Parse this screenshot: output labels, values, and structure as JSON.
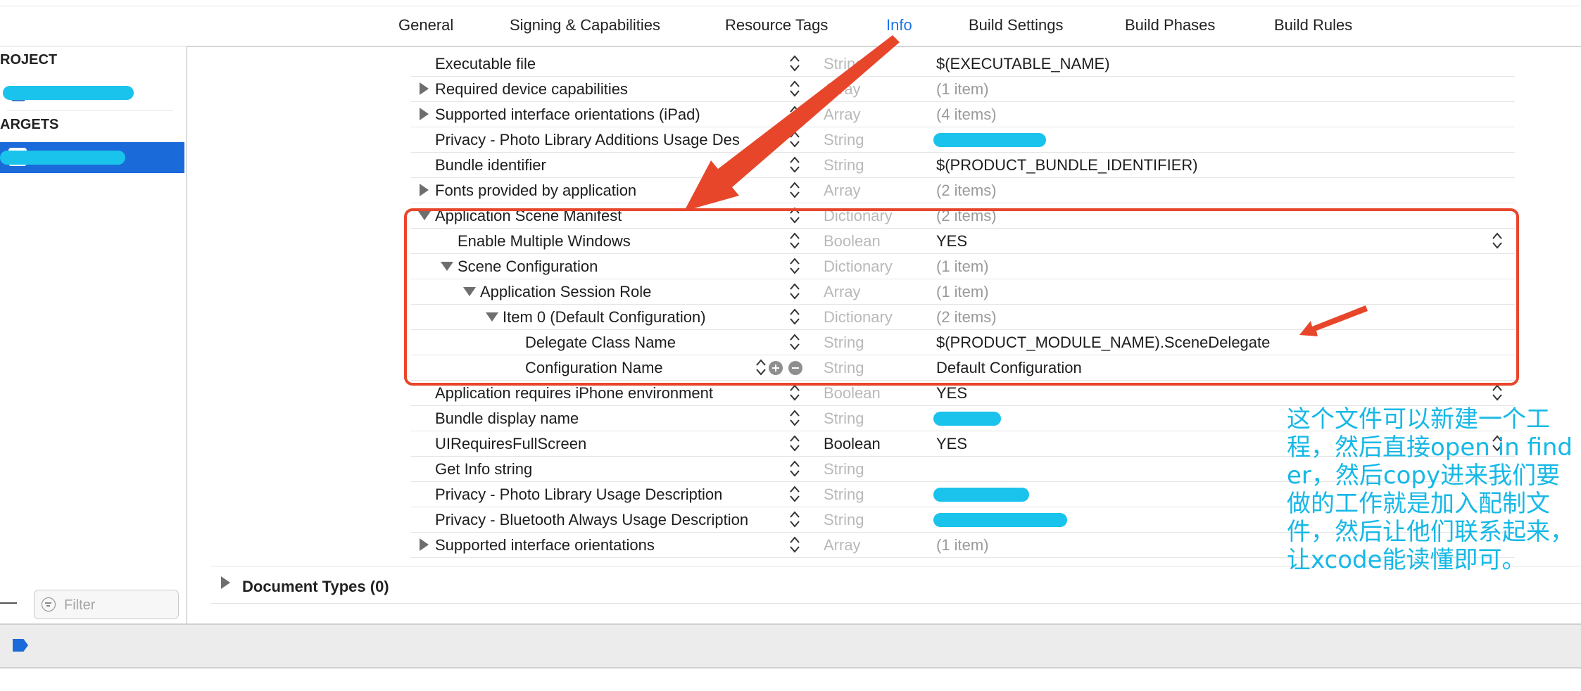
{
  "tabs": [
    {
      "label": "General",
      "active": false
    },
    {
      "label": "Signing & Capabilities",
      "active": false
    },
    {
      "label": "Resource Tags",
      "active": false
    },
    {
      "label": "Info",
      "active": true
    },
    {
      "label": "Build Settings",
      "active": false
    },
    {
      "label": "Build Phases",
      "active": false
    },
    {
      "label": "Build Rules",
      "active": false
    }
  ],
  "sidebar": {
    "project_heading": "ROJECT",
    "targets_heading": "ARGETS",
    "filter_placeholder": "Filter"
  },
  "plist_rows": [
    {
      "key": "Executable file",
      "type": "String",
      "value": "$(EXECUTABLE_NAME)"
    },
    {
      "key": "Required device capabilities",
      "type": "Array",
      "value": "(1 item)",
      "disclosure": "collapsed"
    },
    {
      "key": "Supported interface orientations (iPad)",
      "type": "Array",
      "value": "(4 items)",
      "disclosure": "collapsed"
    },
    {
      "key": "Privacy - Photo Library Additions Usage Des",
      "type": "String",
      "value": ""
    },
    {
      "key": "Bundle identifier",
      "type": "String",
      "value": "$(PRODUCT_BUNDLE_IDENTIFIER)"
    },
    {
      "key": "Fonts provided by application",
      "type": "Array",
      "value": "(2 items)",
      "disclosure": "collapsed"
    },
    {
      "key": "Application Scene Manifest",
      "type": "Dictionary",
      "value": "(2 items)",
      "disclosure": "expanded"
    },
    {
      "key": "Enable Multiple Windows",
      "type": "Boolean",
      "value": "YES",
      "indent": 1
    },
    {
      "key": "Scene Configuration",
      "type": "Dictionary",
      "value": "(1 item)",
      "disclosure": "expanded",
      "indent": 1
    },
    {
      "key": "Application Session Role",
      "type": "Array",
      "value": "(1 item)",
      "disclosure": "expanded",
      "indent": 2
    },
    {
      "key": "Item 0 (Default Configuration)",
      "type": "Dictionary",
      "value": "(2 items)",
      "disclosure": "expanded",
      "indent": 3
    },
    {
      "key": "Delegate Class Name",
      "type": "String",
      "value": "$(PRODUCT_MODULE_NAME).SceneDelegate",
      "indent": 4
    },
    {
      "key": "Configuration Name",
      "type": "String",
      "value": "Default Configuration",
      "indent": 4
    },
    {
      "key": "Application requires iPhone environment",
      "type": "Boolean",
      "value": "YES"
    },
    {
      "key": "Bundle display name",
      "type": "String",
      "value": ""
    },
    {
      "key": "UIRequiresFullScreen",
      "type": "Boolean",
      "value": "YES"
    },
    {
      "key": "Get Info string",
      "type": "String",
      "value": ""
    },
    {
      "key": "Privacy - Photo Library Usage Description",
      "type": "String",
      "value": ""
    },
    {
      "key": "Privacy - Bluetooth Always Usage Description",
      "type": "String",
      "value": ""
    },
    {
      "key": "Supported interface orientations",
      "type": "Array",
      "value": "(1 item)",
      "disclosure": "collapsed"
    }
  ],
  "document_types": "Document Types (0)",
  "annotation_note": "这个文件可以新建一个工程，然后直接open in finder，然后copy进来我们要做的工作就是加入配制文件，然后让他们联系起来，让xcode能读懂即可。",
  "colors": {
    "accent": "#1e73e8",
    "selection": "#1b6ad9",
    "annotation_red": "#e8462b",
    "annotation_cyan": "#16b8e6"
  }
}
